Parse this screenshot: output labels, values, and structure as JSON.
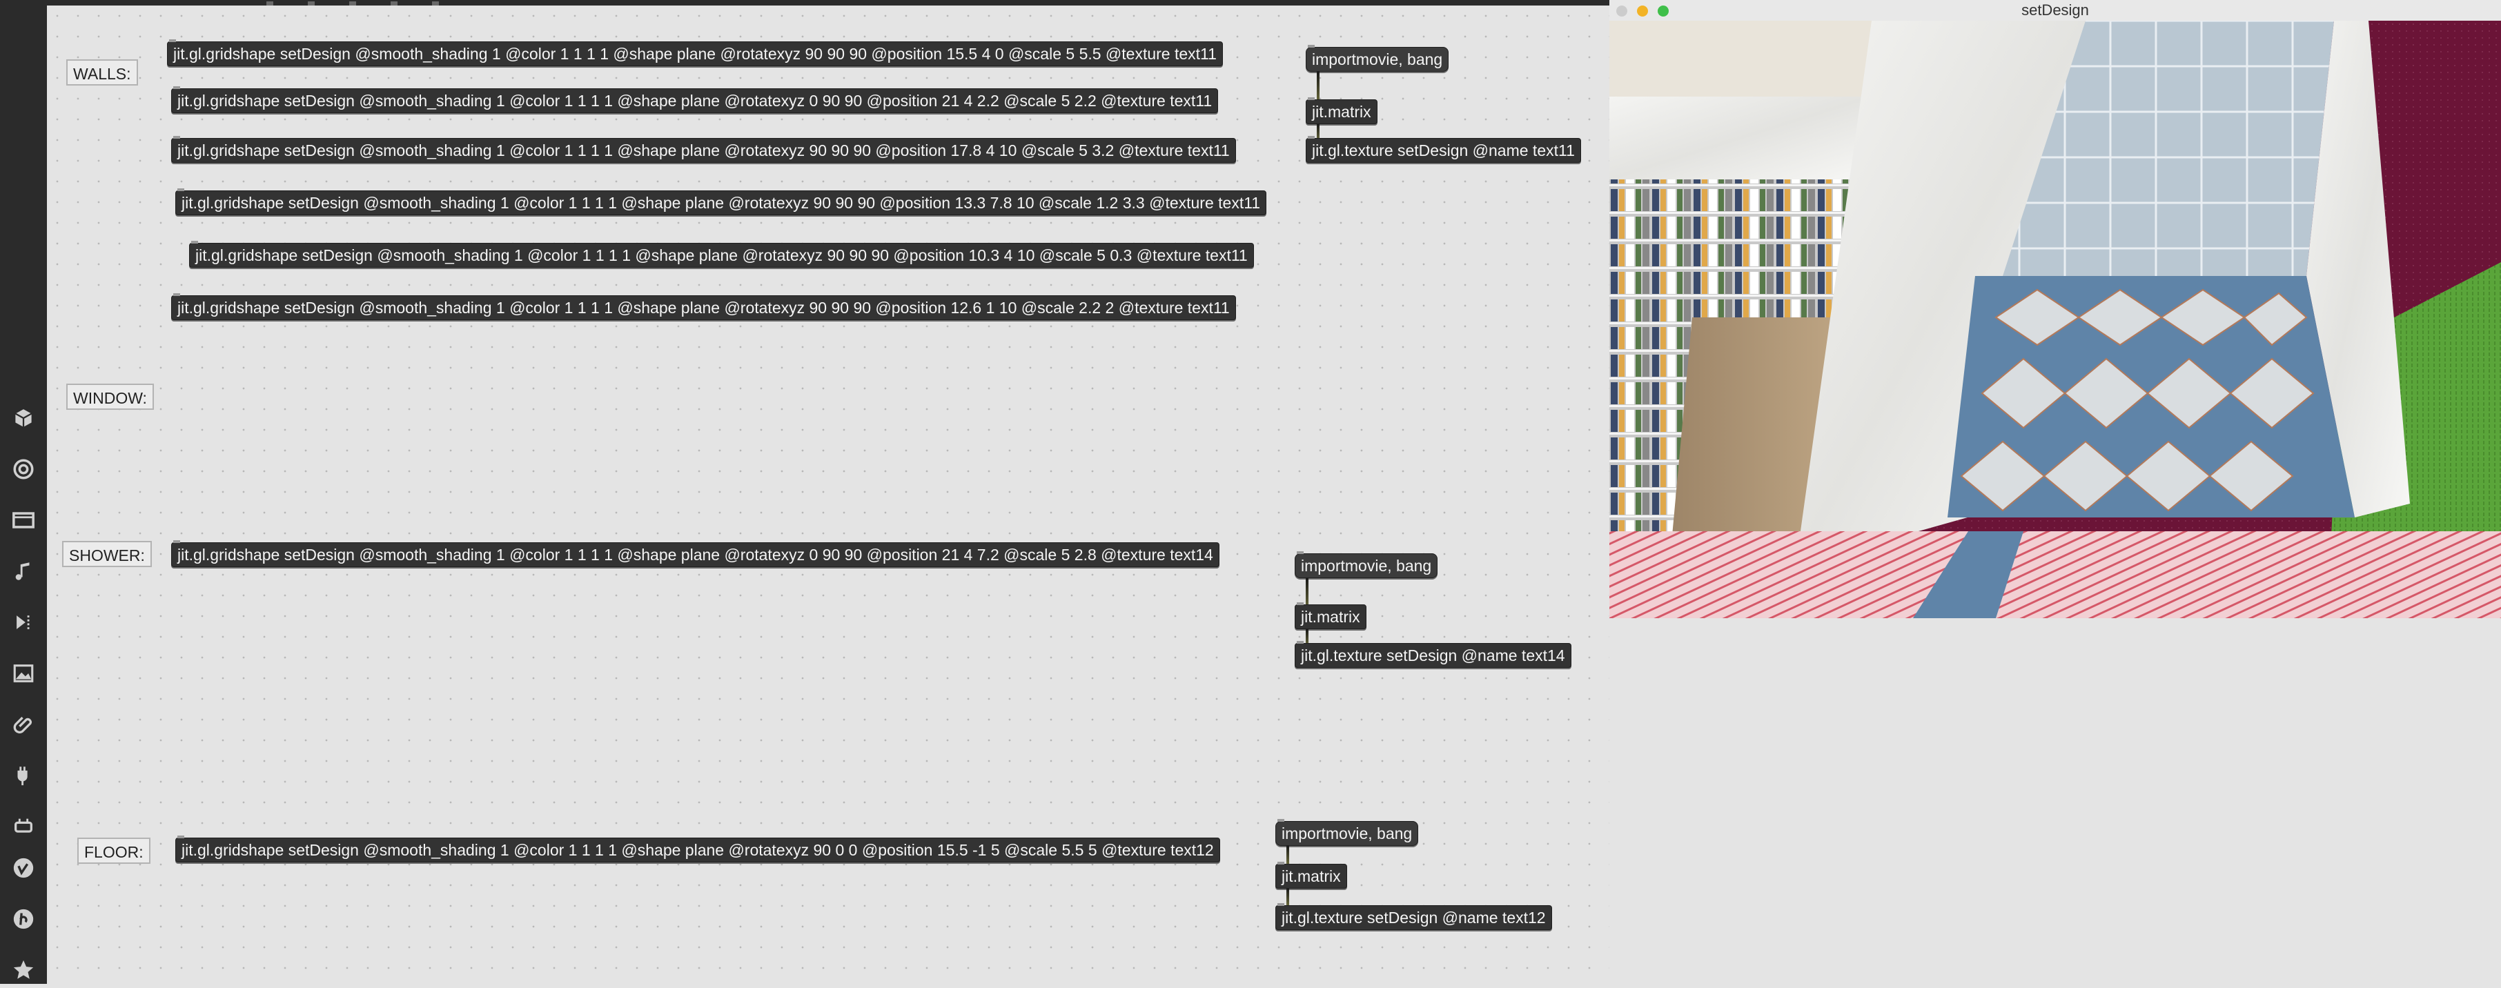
{
  "viewer": {
    "title": "setDesign"
  },
  "sidebar": {
    "icons": [
      "cube-icon",
      "circle-target-icon",
      "film-icon",
      "music-note-icon",
      "sequencer-icon",
      "image-icon",
      "paperclip-icon",
      "plug-icon",
      "connector-icon",
      "vimeo-icon",
      "b-logo-icon",
      "star-icon"
    ]
  },
  "comments": {
    "walls": "WALLS:",
    "window": "WINDOW:",
    "shower": "SHOWER:",
    "floor": "FLOOR:"
  },
  "walls": {
    "objects": [
      "jit.gl.gridshape setDesign @smooth_shading 1 @color 1 1 1 1 @shape plane @rotatexyz 90 90 90 @position 15.5 4 0 @scale 5 5.5 @texture text11",
      "jit.gl.gridshape setDesign @smooth_shading 1 @color 1 1 1 1 @shape plane @rotatexyz 0 90 90 @position 21 4 2.2 @scale 5 2.2 @texture text11",
      "jit.gl.gridshape setDesign @smooth_shading 1 @color 1 1 1 1 @shape plane @rotatexyz 90 90 90 @position 17.8 4 10 @scale 5 3.2 @texture text11",
      "jit.gl.gridshape setDesign @smooth_shading 1 @color 1 1 1 1 @shape plane @rotatexyz 90 90 90 @position 13.3 7.8 10 @scale 1.2 3.3 @texture text11",
      "jit.gl.gridshape setDesign @smooth_shading 1 @color 1 1 1 1 @shape plane @rotatexyz 90 90 90 @position 10.3 4 10 @scale 5 0.3 @texture text11",
      "jit.gl.gridshape setDesign @smooth_shading 1 @color 1 1 1 1 @shape plane @rotatexyz 90 90 90 @position 12.6 1 10 @scale 2.2 2 @texture text11"
    ],
    "chain": {
      "message": "importmovie, bang",
      "matrix": "jit.matrix",
      "texture": "jit.gl.texture setDesign @name text11"
    }
  },
  "shower": {
    "object": "jit.gl.gridshape setDesign @smooth_shading 1 @color 1 1 1 1 @shape plane @rotatexyz 0 90 90 @position 21 4 7.2 @scale 5 2.8 @texture text14",
    "chain": {
      "message": "importmovie, bang",
      "matrix": "jit.matrix",
      "texture": "jit.gl.texture setDesign @name text14"
    }
  },
  "floor": {
    "object": "jit.gl.gridshape setDesign @smooth_shading 1 @color 1 1 1 1 @shape plane @rotatexyz 90 0 0 @position 15.5 -1 5 @scale 5.5 5 @texture text12",
    "chain": {
      "message": "importmovie, bang",
      "matrix": "jit.matrix",
      "texture": "jit.gl.texture setDesign @name text12"
    }
  },
  "colors": {
    "object_bg": "#333333",
    "canvas_bg": "#e4e4e4",
    "sidebar_bg": "#2b2b2b",
    "maroon": "#6b1437",
    "grass": "#5aa53a",
    "tile_blue": "#5f84a8"
  }
}
